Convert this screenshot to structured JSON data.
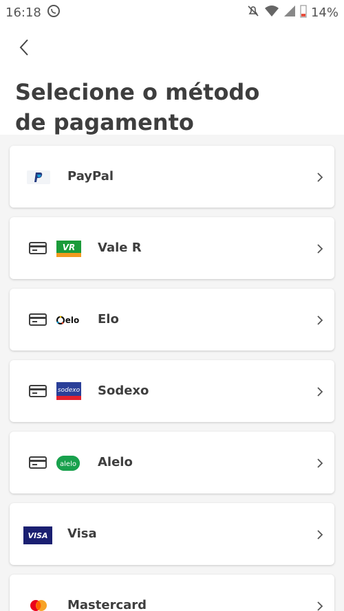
{
  "status_bar": {
    "time": "16:18",
    "battery": "14%",
    "icons": [
      "whatsapp-icon",
      "mute-icon",
      "wifi-icon",
      "signal-icon",
      "battery-icon"
    ]
  },
  "header": {
    "back_icon": "chevron-left-icon",
    "title": "Selecione o método de pagamento"
  },
  "payment_methods": [
    {
      "label": "PayPal",
      "logo": "paypal-logo",
      "card_icon": false
    },
    {
      "label": "Vale R",
      "logo": "vr-logo",
      "card_icon": true
    },
    {
      "label": "Elo",
      "logo": "elo-logo",
      "card_icon": true
    },
    {
      "label": "Sodexo",
      "logo": "sodexo-logo",
      "card_icon": true
    },
    {
      "label": "Alelo",
      "logo": "alelo-logo",
      "card_icon": true
    },
    {
      "label": "Visa",
      "logo": "visa-logo",
      "card_icon": false
    },
    {
      "label": "Mastercard",
      "logo": "mastercard-logo",
      "card_icon": false
    }
  ],
  "logo_text": {
    "vr": "VR",
    "elo": "elo",
    "sodexo": "sodexo",
    "alelo": "alelo",
    "visa": "VISA"
  },
  "colors": {
    "title": "#3e3e3e",
    "background": "#f5f5f5",
    "card": "#ffffff",
    "vr_green": "#1b9b3a",
    "vr_orange": "#f29a1f",
    "sodexo_blue": "#2a3f98",
    "sodexo_red": "#e3212e",
    "alelo_green": "#19a14d",
    "visa_blue": "#1a1f71",
    "mc_red": "#eb001b",
    "mc_orange": "#f79e1b"
  }
}
